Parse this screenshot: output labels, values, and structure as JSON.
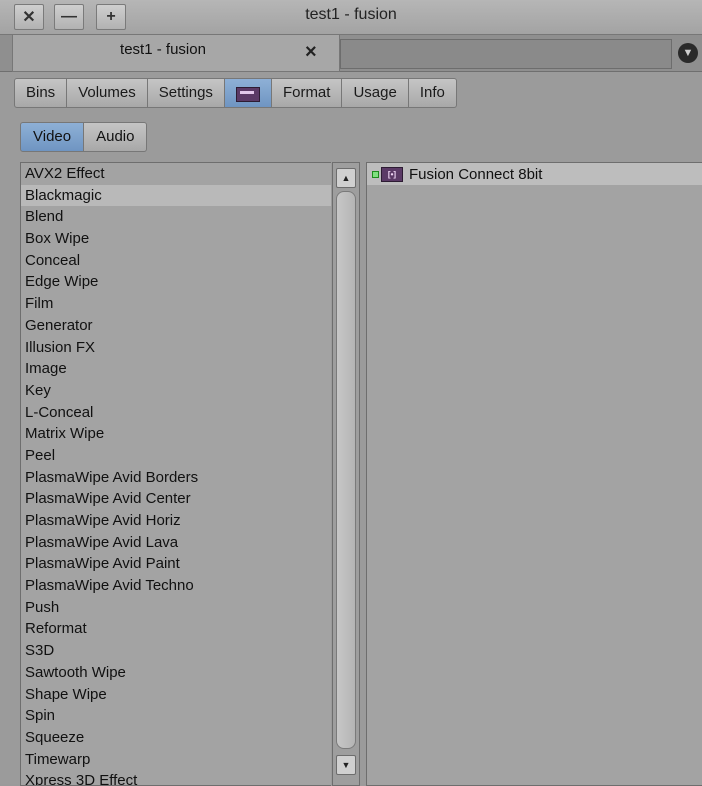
{
  "window": {
    "title": "test1 - fusion",
    "controls": [
      {
        "name": "close-window-button",
        "glyph": "✕"
      },
      {
        "name": "minimize-window-button",
        "glyph": "—"
      },
      {
        "name": "zoom-window-button",
        "glyph": "+"
      }
    ]
  },
  "bin_tab": {
    "label": "test1 - fusion",
    "close_glyph": "×"
  },
  "menu_icon_glyph": "▼",
  "toolbar": {
    "tabs": [
      {
        "name": "tab-bins",
        "label": "Bins",
        "active": false
      },
      {
        "name": "tab-volumes",
        "label": "Volumes",
        "active": false
      },
      {
        "name": "tab-settings",
        "label": "Settings",
        "active": false
      },
      {
        "name": "tab-effects",
        "label": "",
        "icon": "effect-icon",
        "active": true
      },
      {
        "name": "tab-format",
        "label": "Format",
        "active": false
      },
      {
        "name": "tab-usage",
        "label": "Usage",
        "active": false
      },
      {
        "name": "tab-info",
        "label": "Info",
        "active": false
      }
    ]
  },
  "media_toggle": {
    "video_label": "Video",
    "audio_label": "Audio",
    "selected": "Video"
  },
  "categories": [
    "AVX2 Effect",
    "Blackmagic",
    "Blend",
    "Box Wipe",
    "Conceal",
    "Edge Wipe",
    "Film",
    "Generator",
    "Illusion FX",
    "Image",
    "Key",
    "L-Conceal",
    "Matrix Wipe",
    "Peel",
    "PlasmaWipe Avid Borders",
    "PlasmaWipe Avid Center",
    "PlasmaWipe Avid Horiz",
    "PlasmaWipe Avid Lava",
    "PlasmaWipe Avid Paint",
    "PlasmaWipe Avid Techno",
    "Push",
    "Reformat",
    "S3D",
    "Sawtooth Wipe",
    "Shape Wipe",
    "Spin",
    "Squeeze",
    "Timewarp",
    "Xpress 3D Effect"
  ],
  "selected_category": "Blackmagic",
  "scroll": {
    "up_glyph": "▲",
    "down_glyph": "▼"
  },
  "effects": [
    {
      "label": "Fusion Connect 8bit",
      "badge": "[•]"
    }
  ],
  "colors": {
    "selected_tab": "#7a9fcb",
    "effect_badge": "#5b3a66"
  }
}
